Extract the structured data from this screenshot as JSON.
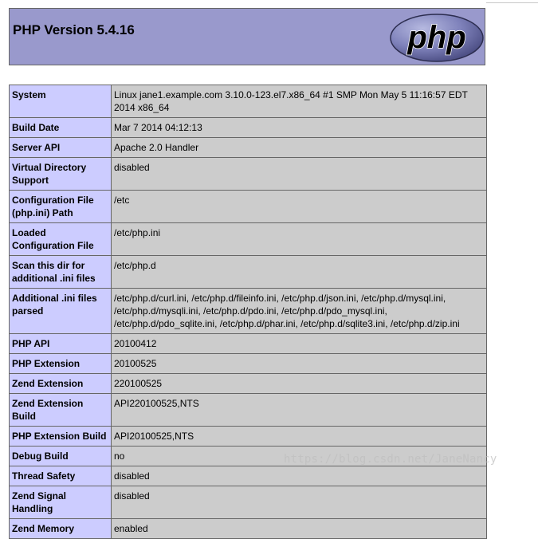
{
  "header": {
    "title": "PHP Version 5.4.16",
    "logo_text": "php"
  },
  "rows": [
    {
      "label": "System",
      "value": "Linux jane1.example.com 3.10.0-123.el7.x86_64 #1 SMP Mon May 5 11:16:57 EDT 2014 x86_64"
    },
    {
      "label": "Build Date",
      "value": "Mar 7 2014 04:12:13"
    },
    {
      "label": "Server API",
      "value": "Apache 2.0 Handler"
    },
    {
      "label": "Virtual Directory Support",
      "value": "disabled"
    },
    {
      "label": "Configuration File (php.ini) Path",
      "value": "/etc"
    },
    {
      "label": "Loaded Configuration File",
      "value": "/etc/php.ini"
    },
    {
      "label": "Scan this dir for additional .ini files",
      "value": "/etc/php.d"
    },
    {
      "label": "Additional .ini files parsed",
      "value": "/etc/php.d/curl.ini, /etc/php.d/fileinfo.ini, /etc/php.d/json.ini, /etc/php.d/mysql.ini, /etc/php.d/mysqli.ini, /etc/php.d/pdo.ini, /etc/php.d/pdo_mysql.ini, /etc/php.d/pdo_sqlite.ini, /etc/php.d/phar.ini, /etc/php.d/sqlite3.ini, /etc/php.d/zip.ini"
    },
    {
      "label": "PHP API",
      "value": "20100412"
    },
    {
      "label": "PHP Extension",
      "value": "20100525"
    },
    {
      "label": "Zend Extension",
      "value": "220100525"
    },
    {
      "label": "Zend Extension Build",
      "value": "API220100525,NTS"
    },
    {
      "label": "PHP Extension Build",
      "value": "API20100525,NTS"
    },
    {
      "label": "Debug Build",
      "value": "no"
    },
    {
      "label": "Thread Safety",
      "value": "disabled"
    },
    {
      "label": "Zend Signal Handling",
      "value": "disabled"
    },
    {
      "label": "Zend Memory",
      "value": "enabled"
    }
  ],
  "watermark": "https://blog.csdn.net/JaneNancy",
  "colors": {
    "header_bg": "#9999cc",
    "label_bg": "#ccccff",
    "value_bg": "#cccccc",
    "border": "#666666"
  }
}
